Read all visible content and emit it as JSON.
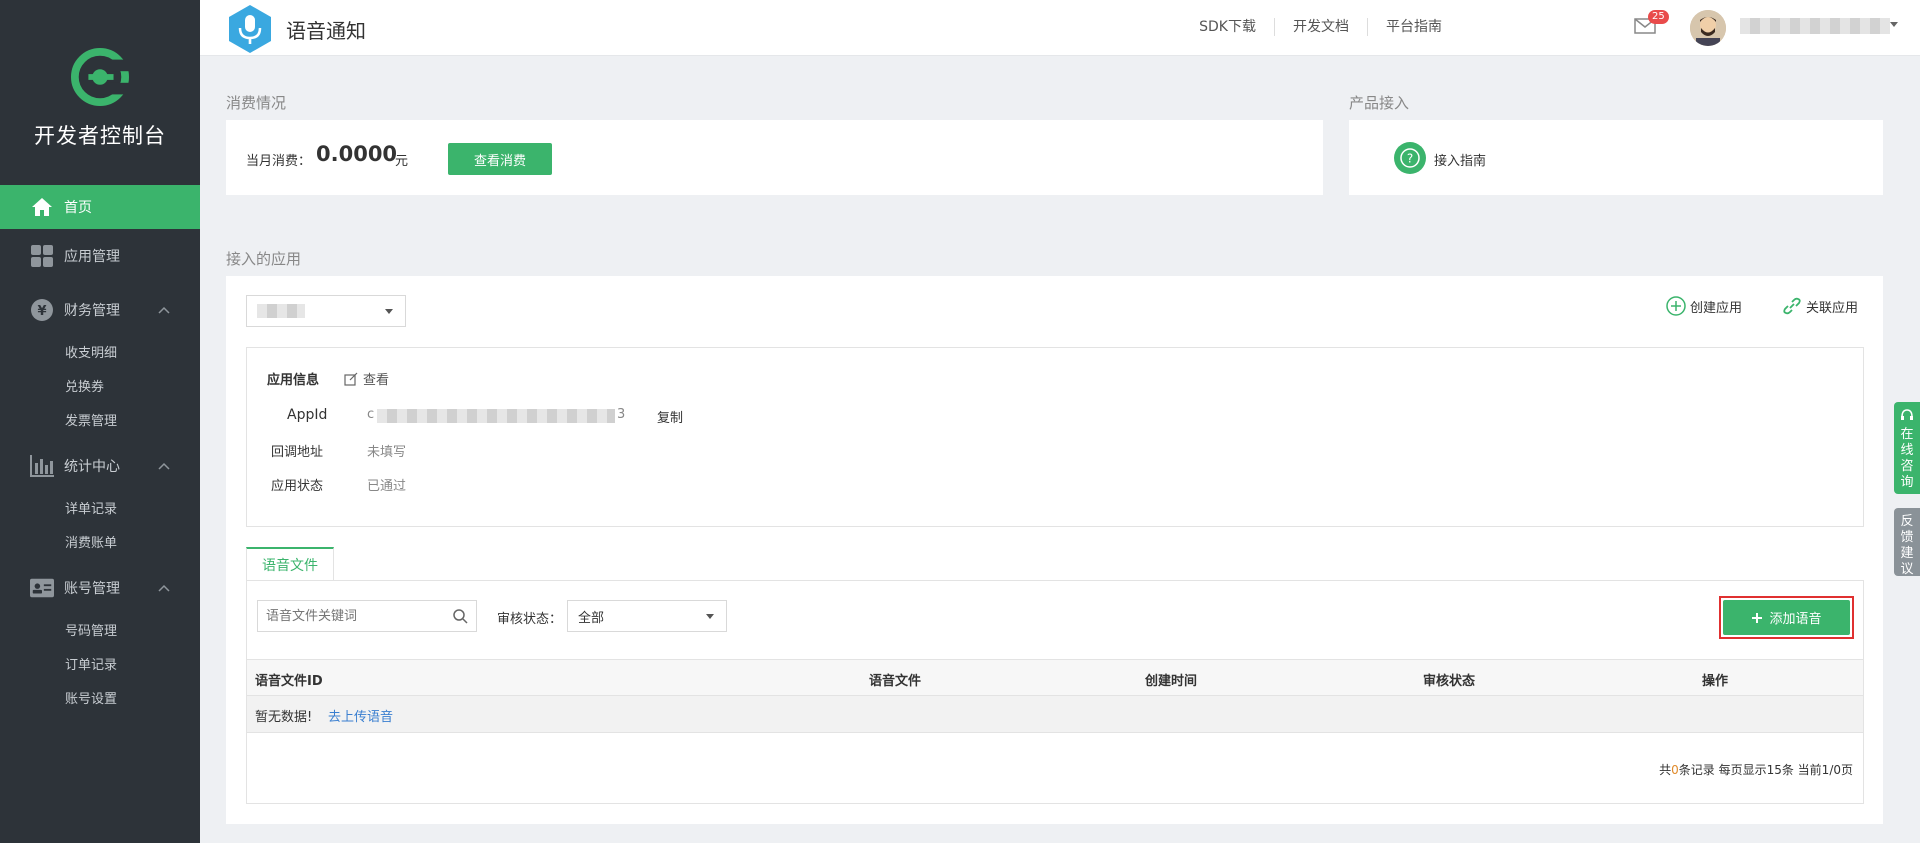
{
  "sidebar": {
    "brand": "开发者控制台",
    "nav": {
      "home": "首页",
      "apps": "应用管理",
      "finance": "财务管理",
      "finance_sub": [
        "收支明细",
        "兑换券",
        "发票管理"
      ],
      "stats": "统计中心",
      "stats_sub": [
        "详单记录",
        "消费账单"
      ],
      "account": "账号管理",
      "account_sub": [
        "号码管理",
        "订单记录",
        "账号设置"
      ]
    }
  },
  "header": {
    "title": "语音通知",
    "links": [
      "SDK下载",
      "开发文档",
      "平台指南"
    ],
    "mail_count": "25",
    "user_name": "h"
  },
  "consumption": {
    "section_title": "消费情况",
    "label": "当月消费：",
    "amount": "0.0000",
    "unit": "元",
    "view_button": "查看消费"
  },
  "product": {
    "section_title": "产品接入",
    "guide": "接入指南"
  },
  "apps": {
    "section_title": "接入的应用",
    "create": "创建应用",
    "link": "关联应用",
    "info_title": "应用信息",
    "view": "查看",
    "appid_label": "AppId",
    "appid_prefix": "c",
    "appid_suffix": "3",
    "copy": "复制",
    "callback_label": "回调地址",
    "callback_value": "未填写",
    "status_label": "应用状态",
    "status_value": "已通过"
  },
  "voice": {
    "tab": "语音文件",
    "search_placeholder": "语音文件关键词",
    "review_label": "审核状态：",
    "review_value": "全部",
    "add_button": "添加语音",
    "columns": [
      "语音文件ID",
      "语音文件",
      "创建时间",
      "审核状态",
      "操作"
    ],
    "empty_text": "暂无数据!",
    "upload_link": "去上传语音",
    "pager_prefix": "共",
    "pager_count": "0",
    "pager_suffix": "条记录 每页显示15条 当前1/0页"
  },
  "float": {
    "online": "在线咨询",
    "feedback": "反馈建议"
  },
  "colors": {
    "primary": "#3bb46c",
    "sidebar": "#2d3339",
    "highlight": "#e03030"
  }
}
